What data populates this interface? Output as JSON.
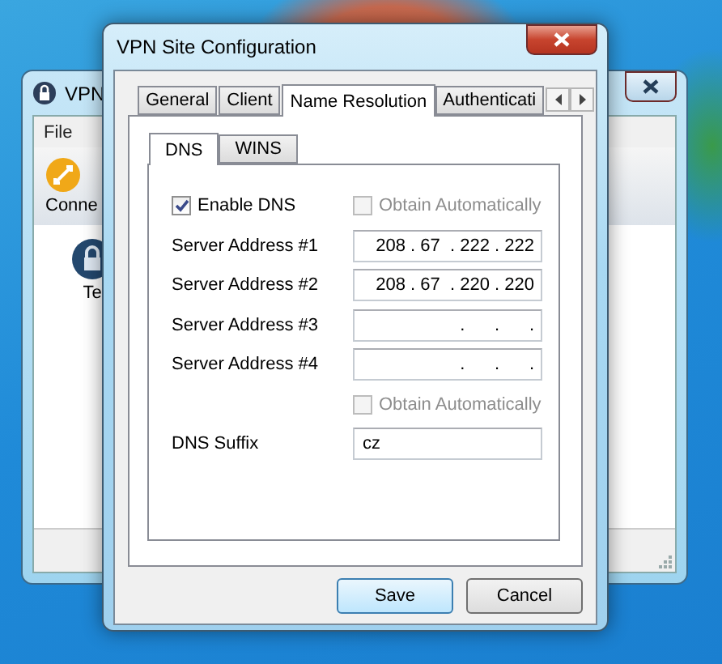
{
  "background_window": {
    "title": "VPN",
    "menu": [
      "File"
    ],
    "toolbar": [
      "Conne"
    ],
    "items": [
      "Te"
    ]
  },
  "dialog": {
    "title": "VPN Site Configuration",
    "tabs": [
      {
        "label": "General",
        "selected": false
      },
      {
        "label": "Client",
        "selected": false
      },
      {
        "label": "Name Resolution",
        "selected": true
      },
      {
        "label": "Authenticati",
        "selected": false
      }
    ],
    "subtabs": [
      {
        "label": "DNS",
        "selected": true
      },
      {
        "label": "WINS",
        "selected": false
      }
    ],
    "enable_dns": {
      "label": "Enable DNS",
      "checked": true,
      "disabled": false
    },
    "obtain_servers": {
      "label": "Obtain Automatically",
      "checked": false,
      "disabled": true
    },
    "servers": [
      {
        "label": "Server Address #1",
        "value": "208 . 67  . 222 . 222"
      },
      {
        "label": "Server Address #2",
        "value": "208 . 67  . 220 . 220"
      },
      {
        "label": "Server Address #3",
        "value": ".      .      ."
      },
      {
        "label": "Server Address #4",
        "value": ".      .      ."
      }
    ],
    "obtain_suffix": {
      "label": "Obtain Automatically",
      "checked": false,
      "disabled": true
    },
    "suffix": {
      "label": "DNS Suffix",
      "value": "cz"
    },
    "buttons": [
      {
        "label": "Save",
        "default": true
      },
      {
        "label": "Cancel",
        "default": false
      }
    ]
  }
}
